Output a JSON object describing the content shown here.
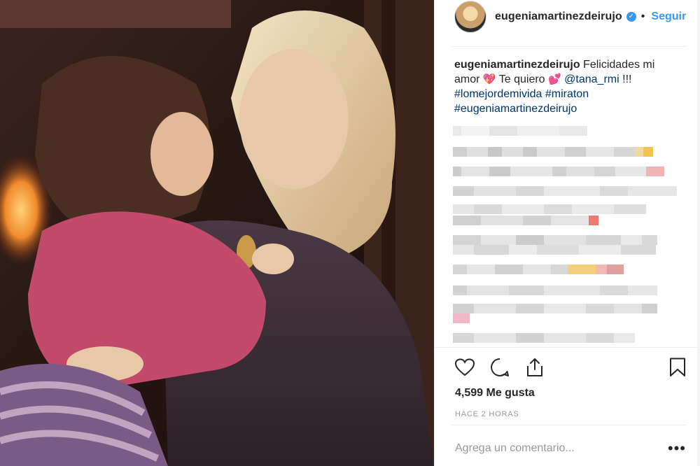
{
  "post": {
    "username": "eugeniamartinezdeirujo",
    "dot": "•",
    "follow_label": "Seguir",
    "caption": {
      "username": "eugeniamartinezdeirujo",
      "text_1": "Felicidades mi amor",
      "emoji_1": "💖",
      "text_2": "Te quiero",
      "emoji_2": "💕",
      "mention": "@tana_rmi",
      "text_3": "!!!",
      "hashtag_1": "#lomejordemivida",
      "hashtag_2": "#miraton",
      "hashtag_3": "#eugeniamartinezdeirujo"
    },
    "likes": "4,599 Me gusta",
    "time": "HACE 2 HORAS",
    "comment_placeholder": "Agrega un comentario...",
    "more_label": "•••"
  },
  "icons": {
    "like": "heart-icon",
    "comment": "comment-icon",
    "share": "share-icon",
    "save": "bookmark-icon",
    "verified": "verified-badge-icon"
  },
  "colors": {
    "accent": "#3897f0",
    "text": "#262626",
    "muted": "#999999",
    "link": "#003569"
  }
}
